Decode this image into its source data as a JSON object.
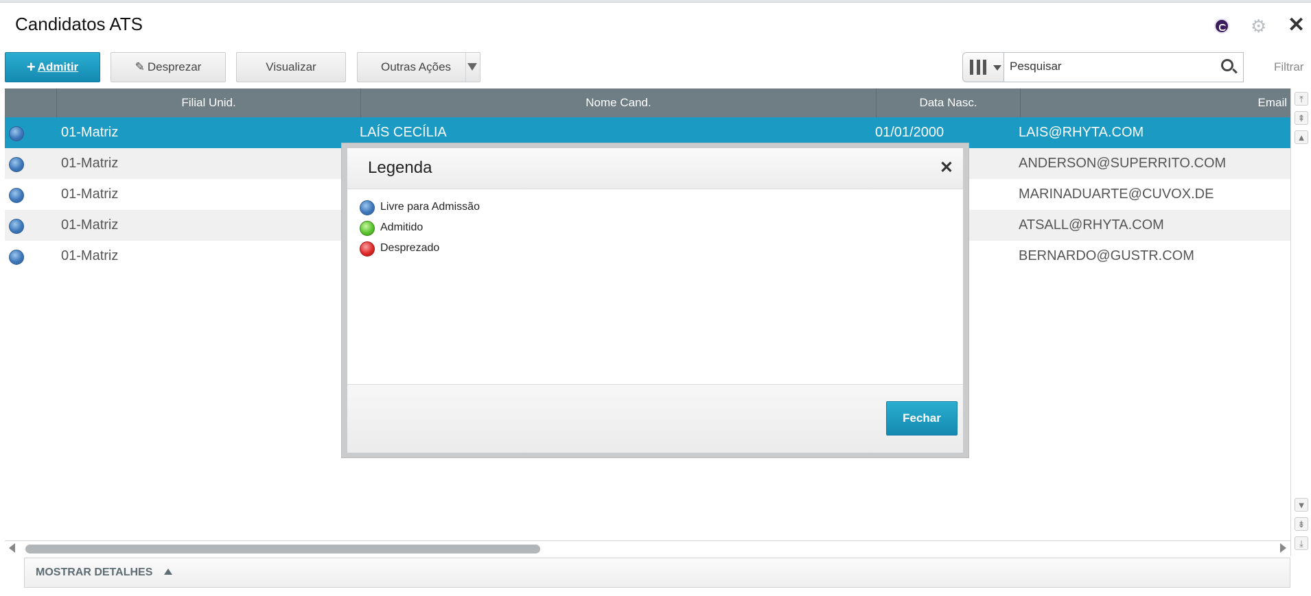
{
  "window": {
    "title": "Candidatos ATS"
  },
  "toolbar": {
    "admitir": "Admitir",
    "desprezar": "Desprezar",
    "visualizar": "Visualizar",
    "outras_acoes": "Outras Ações",
    "search_placeholder": "Pesquisar",
    "filtrar": "Filtrar"
  },
  "grid": {
    "columns": [
      "",
      "Filial Unid.",
      "Nome Cand.",
      "Data Nasc.",
      "Email"
    ],
    "rows": [
      {
        "status": "Livre para Admissão",
        "filial": "01-Matriz",
        "nome": "LAÍS CECÍLIA",
        "data": "01/01/2000",
        "email": "LAIS@RHYTA.COM"
      },
      {
        "status": "Livre para Admissão",
        "filial": "01-Matriz",
        "nome": "",
        "data": "",
        "email": "ANDERSON@SUPERRITO.COM"
      },
      {
        "status": "Livre para Admissão",
        "filial": "01-Matriz",
        "nome": "",
        "data": "",
        "email": "MARINADUARTE@CUVOX.DE"
      },
      {
        "status": "Livre para Admissão",
        "filial": "01-Matriz",
        "nome": "",
        "data": "",
        "email": "ATSALL@RHYTA.COM"
      },
      {
        "status": "Livre para Admissão",
        "filial": "01-Matriz",
        "nome": "",
        "data": "",
        "email": "BERNARDO@GUSTR.COM"
      }
    ]
  },
  "footer": {
    "details": "MOSTRAR DETALHES"
  },
  "modal": {
    "title": "Legenda",
    "items": [
      {
        "label": "Livre para Admissão",
        "color": "#3e78bb"
      },
      {
        "label": "Admitido",
        "color": "#5bc42e"
      },
      {
        "label": "Desprezado",
        "color": "#e02a2a"
      }
    ],
    "close_button": "Fechar"
  },
  "colors": {
    "accent": "#1b9bc4",
    "header": "#6f7e84"
  }
}
